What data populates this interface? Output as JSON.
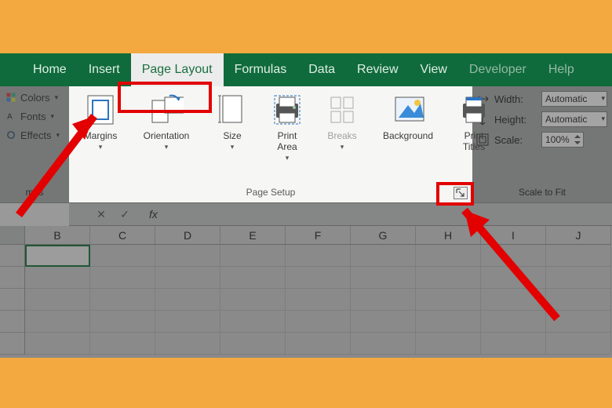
{
  "tabs": {
    "home": "Home",
    "insert": "Insert",
    "pagelayout": "Page Layout",
    "formulas": "Formulas",
    "data": "Data",
    "review": "Review",
    "view": "View",
    "developer": "Developer",
    "help": "Help"
  },
  "themes": {
    "colors": "Colors",
    "fonts": "Fonts",
    "effects": "Effects",
    "group": "mes"
  },
  "page_setup": {
    "margins": "Margins",
    "orientation": "Orientation",
    "size": "Size",
    "print_area": "Print\nArea",
    "breaks": "Breaks",
    "background": "Background",
    "print_titles": "Print\nTitles",
    "group": "Page Setup"
  },
  "scale": {
    "width_label": "Width:",
    "width_value": "Automatic",
    "height_label": "Height:",
    "height_value": "Automatic",
    "scale_label": "Scale:",
    "scale_value": "100%",
    "group": "Scale to Fit"
  },
  "formula_bar": {
    "fx": "fx"
  },
  "columns": [
    "B",
    "C",
    "D",
    "E",
    "F",
    "G",
    "H",
    "I",
    "J"
  ]
}
